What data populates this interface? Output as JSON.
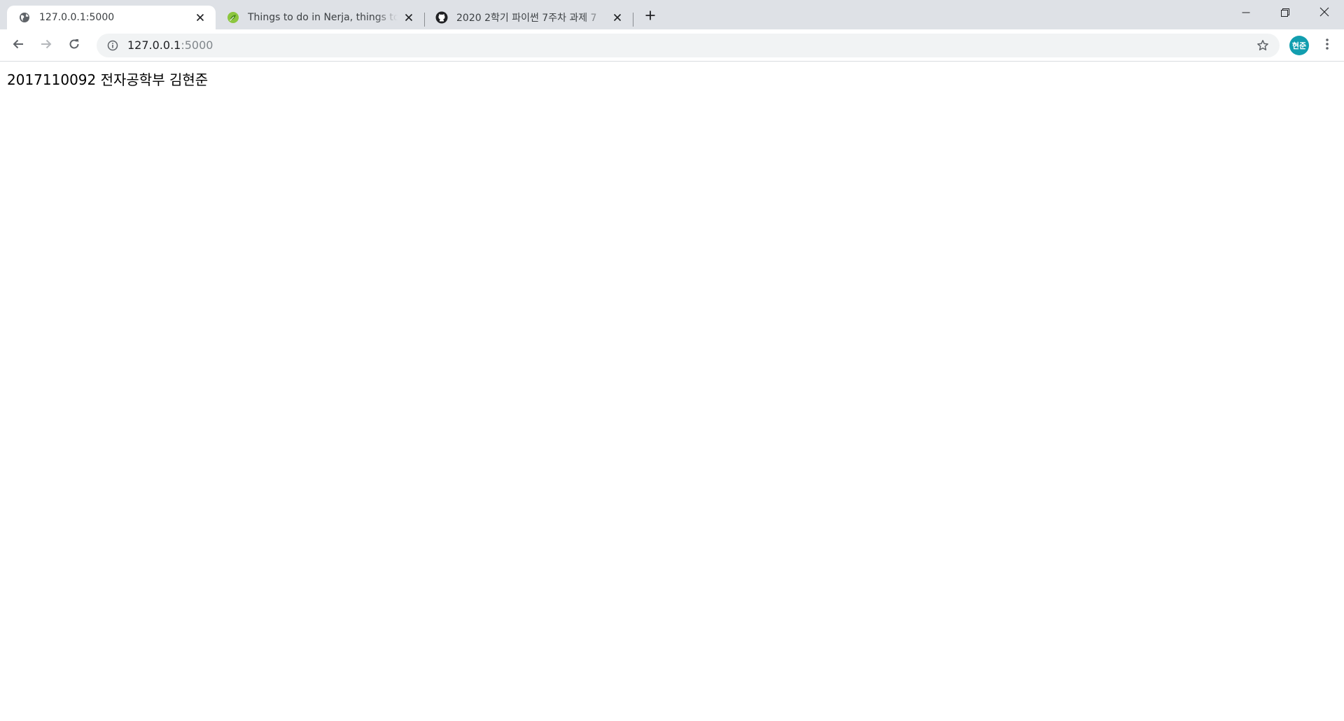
{
  "browser": {
    "tabs": [
      {
        "title": "127.0.0.1:5000",
        "icon": "globe-icon",
        "active": true
      },
      {
        "title": "Things to do in Nerja, things to do in Nerja",
        "icon": "leaf-icon",
        "active": false
      },
      {
        "title": "2020 2학기 파이썬 7주차 과제 7",
        "icon": "github-icon",
        "active": false
      }
    ],
    "address": {
      "host": "127.0.0.1",
      "port": ":5000"
    },
    "profile_initials": "현준"
  },
  "page": {
    "text": "2017110092 전자공학부 김현준"
  },
  "colors": {
    "tabstrip_bg": "#dee1e6",
    "omnibox_bg": "#f1f3f4",
    "avatar_bg": "#129eaf"
  }
}
